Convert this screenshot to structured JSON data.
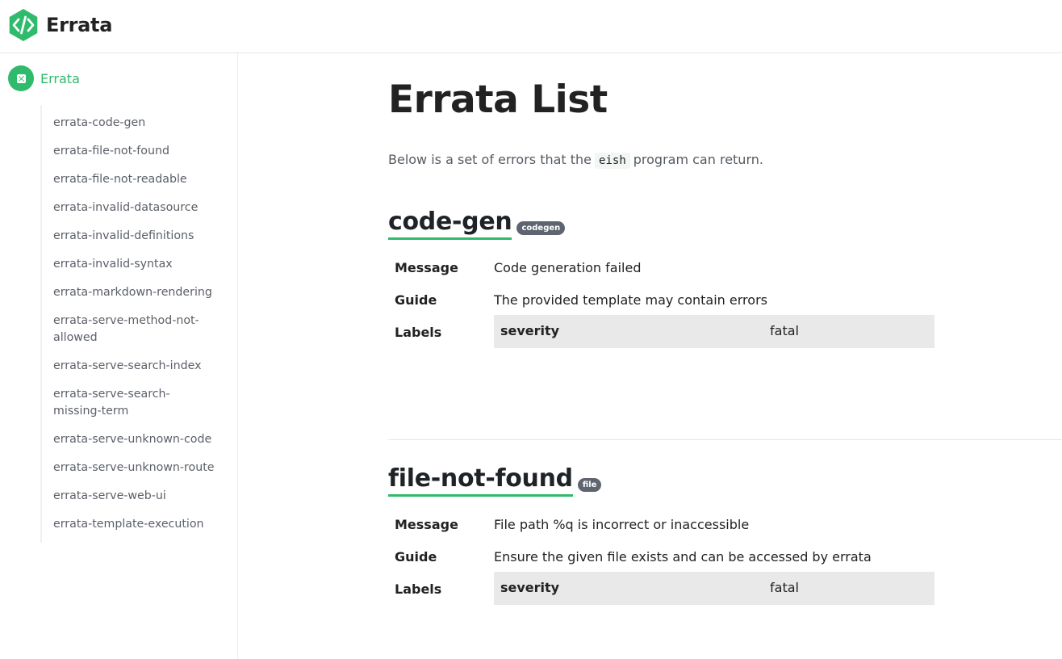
{
  "header": {
    "title": "Errata",
    "logo_icon": "code-brackets-icon",
    "accent": "#2fba6c"
  },
  "sidebar": {
    "group_label": "Errata",
    "group_icon": "close-square-icon",
    "items": [
      "errata-code-gen",
      "errata-file-not-found",
      "errata-file-not-readable",
      "errata-invalid-datasource",
      "errata-invalid-definitions",
      "errata-invalid-syntax",
      "errata-markdown-rendering",
      "errata-serve-method-not-allowed",
      "errata-serve-search-index",
      "errata-serve-search-missing-term",
      "errata-serve-unknown-code",
      "errata-serve-unknown-route",
      "errata-serve-web-ui",
      "errata-template-execution"
    ]
  },
  "main": {
    "title": "Errata List",
    "intro_before": "Below is a set of errors that the",
    "intro_code": "eish",
    "intro_after": "program can return.",
    "entries": [
      {
        "code": "code-gen",
        "badge": "codegen",
        "message_label": "Message",
        "message": "Code generation failed",
        "guide_label": "Guide",
        "guide": "The provided template may contain errors",
        "labels_label": "Labels",
        "label_key": "severity",
        "label_value": "fatal"
      },
      {
        "code": "file-not-found",
        "badge": "file",
        "message_label": "Message",
        "message": "File path %q is incorrect or inaccessible",
        "guide_label": "Guide",
        "guide": "Ensure the given file exists and can be accessed by errata",
        "labels_label": "Labels",
        "label_key": "severity",
        "label_value": "fatal"
      }
    ]
  }
}
